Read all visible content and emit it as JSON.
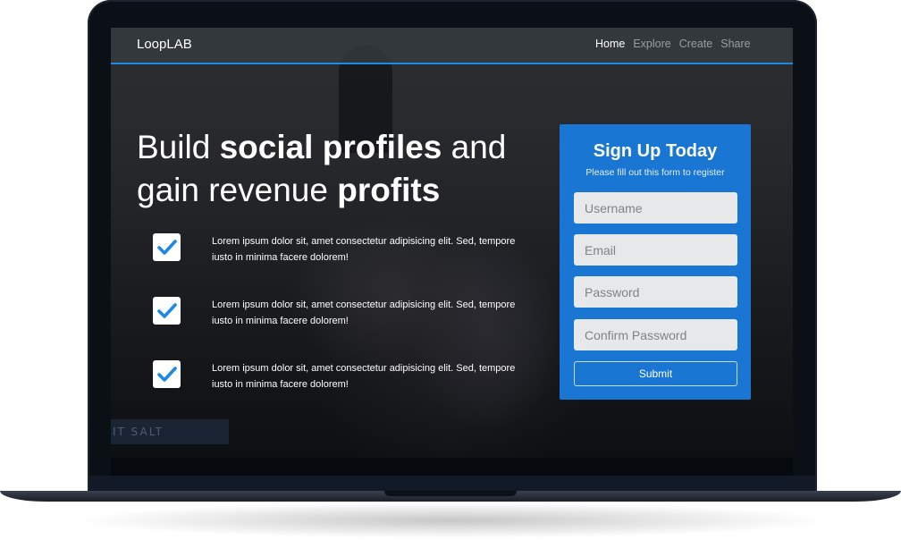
{
  "nav": {
    "brand": "LoopLAB",
    "links": [
      {
        "label": "Home",
        "active": true
      },
      {
        "label": "Explore",
        "active": false
      },
      {
        "label": "Create",
        "active": false
      },
      {
        "label": "Share",
        "active": false
      }
    ]
  },
  "hero": {
    "headline": {
      "part1": "Build ",
      "bold1": "social profiles",
      "part2": " and gain revenue ",
      "bold2": "profits"
    },
    "features": [
      {
        "text": "Lorem ipsum dolor sit, amet consectetur adipisicing elit. Sed, tempore iusto in minima facere dolorem!",
        "icon": "check-icon"
      },
      {
        "text": "Lorem ipsum dolor sit, amet consectetur adipisicing elit. Sed, tempore iusto in minima facere dolorem!",
        "icon": "check-icon"
      },
      {
        "text": "Lorem ipsum dolor sit, amet consectetur adipisicing elit. Sed, tempore iusto in minima facere dolorem!",
        "icon": "check-icon"
      }
    ]
  },
  "signup": {
    "title": "Sign Up Today",
    "subtitle": "Please fill out this form to register",
    "username_placeholder": "Username",
    "email_placeholder": "Email",
    "password_placeholder": "Password",
    "confirm_placeholder": "Confirm Password",
    "submit_label": "Submit"
  },
  "background": {
    "sign_text": "IT SALT"
  },
  "colors": {
    "accent": "#1e88e5",
    "form_bg": "#1976d2",
    "check": "#1e88e5"
  }
}
